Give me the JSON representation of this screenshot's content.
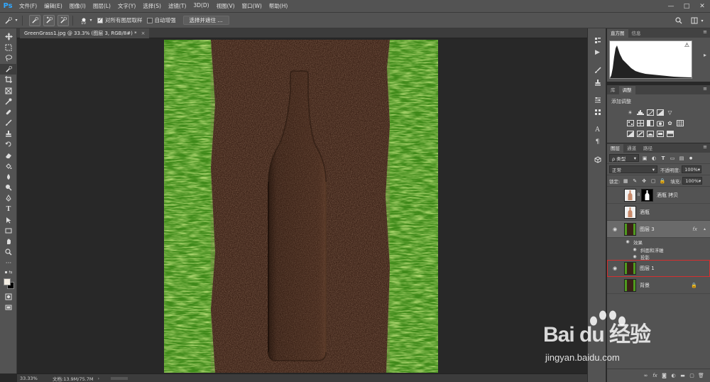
{
  "app": {
    "logo": "Ps"
  },
  "menu": [
    "文件(F)",
    "编辑(E)",
    "图像(I)",
    "图层(L)",
    "文字(Y)",
    "选择(S)",
    "滤镜(T)",
    "3D(D)",
    "视图(V)",
    "窗口(W)",
    "帮助(H)"
  ],
  "window_controls": [
    "—",
    "□",
    "✕"
  ],
  "options": {
    "brush_size": "10",
    "sample_all_layers_label": "对所有图层取样",
    "sample_all_layers_checked": true,
    "auto_enhance_label": "自动增强",
    "auto_enhance_checked": false,
    "select_and_mask_label": "选择并遮住 ..."
  },
  "document_tab": {
    "title": "GreenGrass1.jpg @ 33.3% (图层 3, RGB/8#) *",
    "close": "×"
  },
  "status": {
    "zoom": "33.33%",
    "doc_info": "文档:13.9M/75.7M",
    "arrow": "›"
  },
  "panels": {
    "histogram": {
      "tabs": [
        "直方图",
        "信息"
      ],
      "active_tab": 0,
      "warning": "⚠"
    },
    "adjustments": {
      "tabs": [
        "库",
        "调整"
      ],
      "active_tab": 1,
      "title": "添加调整"
    },
    "layers": {
      "tabs": [
        "图层",
        "通道",
        "路径"
      ],
      "active_tab": 0,
      "filter_kind": "ρ 类型",
      "blend_mode": "正常",
      "opacity_label": "不透明度:",
      "opacity_value": "100%",
      "lock_label": "锁定:",
      "fill_label": "填充:",
      "fill_value": "100%",
      "items": [
        {
          "name": "酒瓶 拷贝",
          "visible": false,
          "thumb": "bottle",
          "has_mask": true
        },
        {
          "name": "酒瓶",
          "visible": false,
          "thumb": "bottle"
        },
        {
          "name": "图层 3",
          "visible": true,
          "thumb": "grass",
          "fx": "fx",
          "selected": true
        },
        {
          "name": "图层 1",
          "visible": true,
          "thumb": "grass",
          "highlighted": true
        },
        {
          "name": "背景",
          "visible": false,
          "thumb": "grass",
          "locked": true
        }
      ],
      "effects_label": "效果",
      "effects": [
        "斜面和浮雕",
        "投影"
      ]
    }
  },
  "watermark": {
    "brand": "Bai du 经验",
    "url": "jingyan.baidu.com"
  },
  "colors": {
    "ui_bg": "#535353",
    "canvas_bg": "#282828",
    "soil": "#3d2418",
    "grass": "#4f9a1f",
    "highlight_box": "#d42f2f",
    "selected_layer": "#6a6a6a"
  }
}
